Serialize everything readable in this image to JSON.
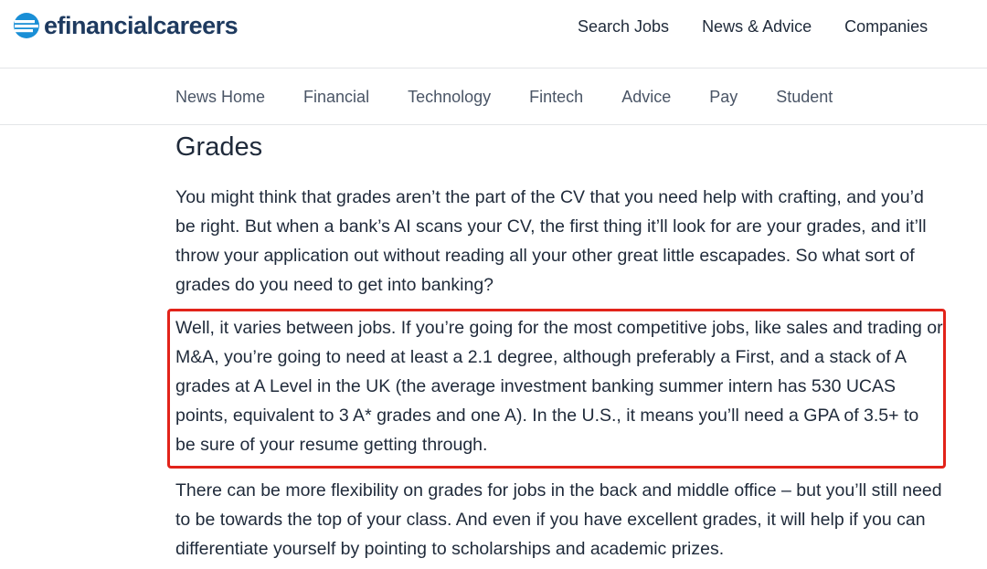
{
  "brand": {
    "name": "efinancialcareers"
  },
  "main_nav": [
    {
      "label": "Search Jobs"
    },
    {
      "label": "News & Advice"
    },
    {
      "label": "Companies"
    }
  ],
  "sub_nav": [
    {
      "label": "News Home"
    },
    {
      "label": "Financial"
    },
    {
      "label": "Technology"
    },
    {
      "label": "Fintech"
    },
    {
      "label": "Advice"
    },
    {
      "label": "Pay"
    },
    {
      "label": "Student"
    }
  ],
  "article": {
    "heading": "Grades",
    "paragraphs": [
      "You might think that grades aren’t the part of the CV that you need help with crafting, and you’d be right. But when a bank’s AI scans your CV, the first thing it’ll look for are your grades, and it’ll throw your application out without reading all your other great little escapades. So what sort of grades do you need to get into banking?",
      "Well, it varies between jobs. If you’re going for the most competitive jobs, like sales and trading or M&A, you’re going to need at least a 2.1 degree, although preferably a First, and a stack of A grades at A Level in the UK (the average investment banking summer intern has 530 UCAS points, equivalent to 3 A* grades and one A). In the U.S., it means you’ll need a GPA of 3.5+ to be sure of your resume getting through.",
      "There can be more flexibility on grades for jobs in the back and middle office – but you’ll still need to be towards the top of your class. And even if you have excellent grades, it will help if you can differentiate yourself by pointing to scholarships and academic prizes."
    ]
  },
  "colors": {
    "brand_navy": "#1e3a5f",
    "brand_blue": "#1a8fd6",
    "highlight_red": "#e2231a"
  }
}
